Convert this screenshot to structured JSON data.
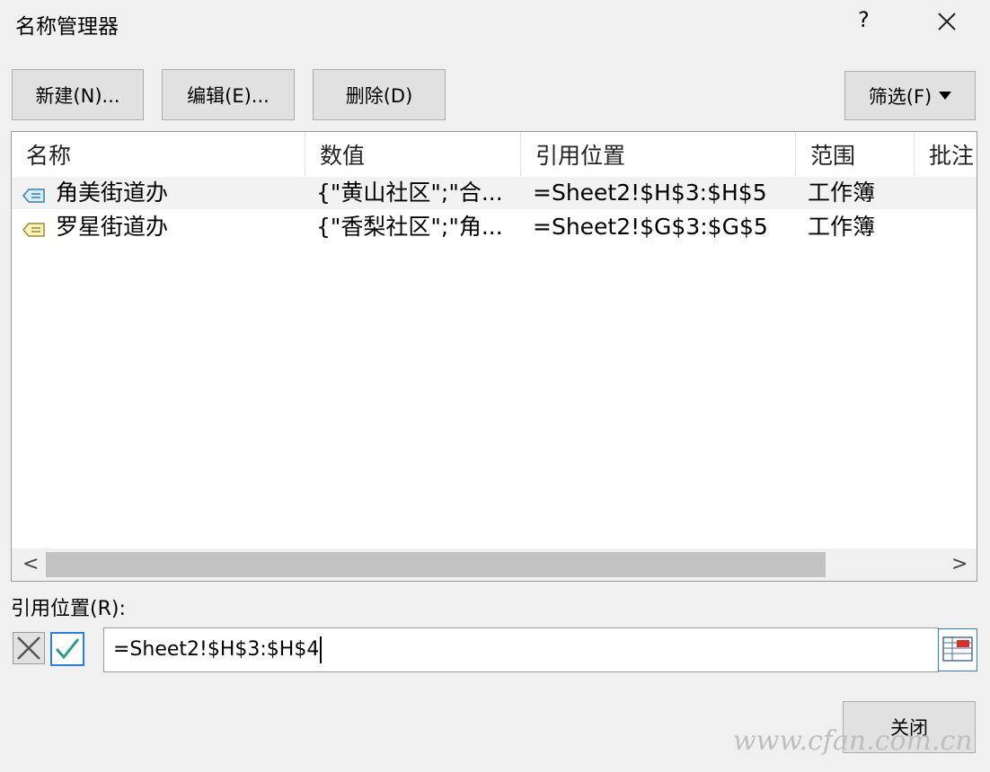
{
  "window": {
    "title": "名称管理器",
    "help": "?"
  },
  "toolbar": {
    "new_label": "新建(N)...",
    "edit_label": "编辑(E)...",
    "delete_label": "删除(D)",
    "filter_label": "筛选(F)"
  },
  "table": {
    "columns": [
      "名称",
      "数值",
      "引用位置",
      "范围",
      "批注"
    ],
    "rows": [
      {
        "name": "角美街道办",
        "value": "{\"黄山社区\";\"合...",
        "ref": "=Sheet2!$H$3:$H$5",
        "scope": "工作簿",
        "comment": ""
      },
      {
        "name": "罗星街道办",
        "value": "{\"香梨社区\";\"角...",
        "ref": "=Sheet2!$G$3:$G$5",
        "scope": "工作簿",
        "comment": ""
      }
    ]
  },
  "scroll": {
    "left": "<",
    "right": ">"
  },
  "ref_panel": {
    "label": "引用位置(R):",
    "value": "=Sheet2!$H$3:$H$4"
  },
  "footer": {
    "close_label": "关闭",
    "watermark": "www.cfan.com.cn"
  },
  "icons": [
    "close-icon",
    "cancel-x-icon",
    "confirm-check-icon",
    "collapse-dialog-icon",
    "name-tag-icon"
  ]
}
